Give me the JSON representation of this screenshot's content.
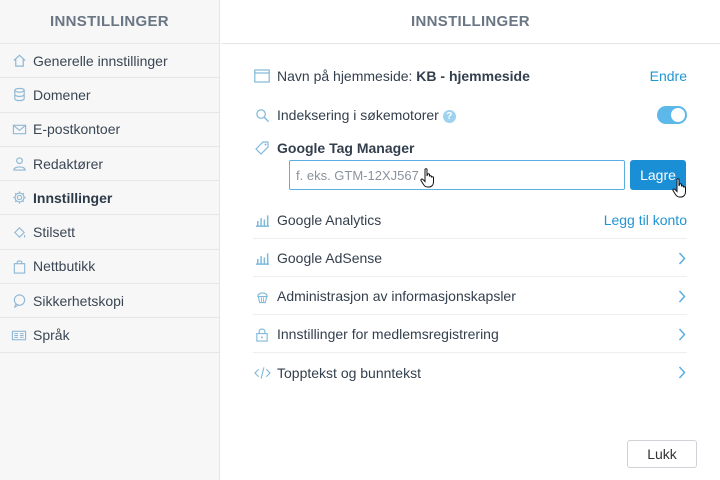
{
  "sidebar": {
    "title": "INNSTILLINGER",
    "items": [
      {
        "label": "Generelle innstillinger",
        "icon": "home-icon"
      },
      {
        "label": "Domener",
        "icon": "database-icon"
      },
      {
        "label": "E-postkontoer",
        "icon": "envelope-icon"
      },
      {
        "label": "Redaktører",
        "icon": "user-icon"
      },
      {
        "label": "Innstillinger",
        "icon": "gear-icon",
        "active": true
      },
      {
        "label": "Stilsett",
        "icon": "paint-bucket-icon"
      },
      {
        "label": "Nettbutikk",
        "icon": "shopping-bag-icon"
      },
      {
        "label": "Sikkerhetskopi",
        "icon": "chat-bubble-icon"
      },
      {
        "label": "Språk",
        "icon": "language-flag-icon"
      }
    ]
  },
  "main": {
    "title": "INNSTILLINGER",
    "site_name": {
      "label": "Navn på hjemmeside:",
      "value": "KB - hjemmeside",
      "action": "Endre",
      "icon": "browser-window-icon"
    },
    "indexing": {
      "label": "Indeksering i søkemotorer",
      "help": "?",
      "enabled": true,
      "icon": "magnifier-icon"
    },
    "gtm": {
      "label": "Google Tag Manager",
      "placeholder": "f. eks. GTM-12XJ567",
      "value": "",
      "save_label": "Lagre",
      "icon": "tag-icon"
    },
    "analytics": {
      "label": "Google Analytics",
      "action": "Legg til konto",
      "icon": "bar-chart-icon"
    },
    "adsense": {
      "label": "Google AdSense",
      "icon": "bar-chart-icon"
    },
    "cookies": {
      "label": "Administrasjon av informasjonskapsler",
      "icon": "cupcake-icon"
    },
    "membership": {
      "label": "Innstillinger for medlemsregistrering",
      "icon": "lock-icon"
    },
    "header_footer": {
      "label": "Topptekst og bunntekst",
      "icon": "code-icon"
    },
    "close_label": "Lukk"
  },
  "colors": {
    "accent": "#2196d3",
    "button": "#1b8fd6",
    "toggle": "#5cb8e8",
    "icon": "#7fb9dc"
  }
}
